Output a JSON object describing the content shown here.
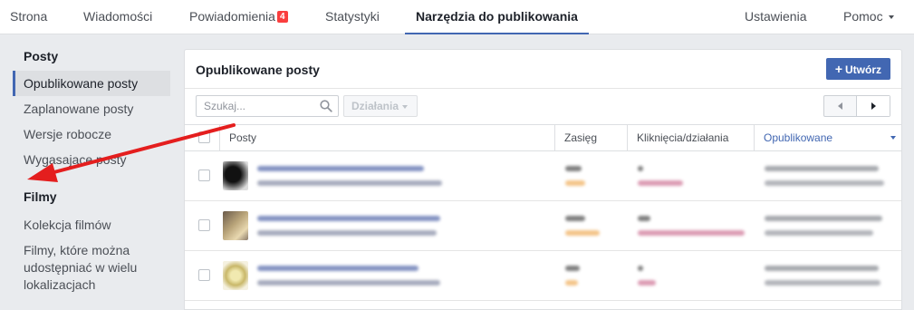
{
  "topnav": {
    "tabs": [
      {
        "label": "Strona"
      },
      {
        "label": "Wiadomości"
      },
      {
        "label": "Powiadomienia",
        "badge": "4"
      },
      {
        "label": "Statystyki"
      },
      {
        "label": "Narzędzia do publikowania",
        "active": true
      }
    ],
    "settings_label": "Ustawienia",
    "help_label": "Pomoc"
  },
  "sidebar": {
    "posts_heading": "Posty",
    "posts_items": [
      {
        "label": "Opublikowane posty",
        "active": true
      },
      {
        "label": "Zaplanowane posty"
      },
      {
        "label": "Wersje robocze"
      },
      {
        "label": "Wygasające posty"
      }
    ],
    "films_heading": "Filmy",
    "films_items": [
      {
        "label": "Kolekcja filmów"
      },
      {
        "label": "Filmy, które można udostępniać w wielu lokalizacjach"
      }
    ]
  },
  "main": {
    "title": "Opublikowane posty",
    "create_label": "Utwórz",
    "search_placeholder": "Szukaj...",
    "actions_label": "Działania",
    "columns": {
      "posts": "Posty",
      "reach": "Zasięg",
      "clicks": "Kliknięcia/działania",
      "published": "Opublikowane"
    }
  },
  "colors": {
    "accent": "#4267b2",
    "badge": "#fa3e3e",
    "arrow": "#e41e1e"
  }
}
